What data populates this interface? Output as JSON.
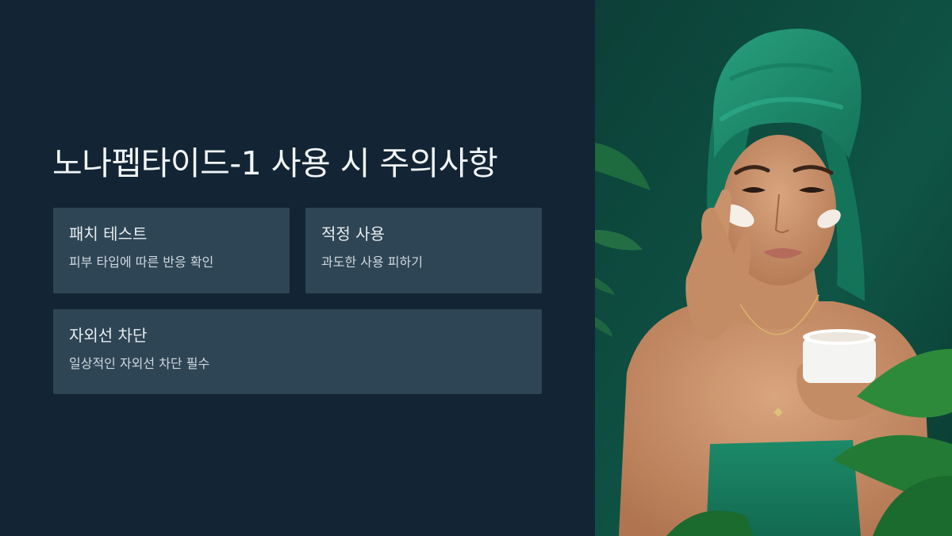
{
  "slide": {
    "title": "노나펩타이드-1 사용 시 주의사항"
  },
  "cards": [
    {
      "title": "패치 테스트",
      "desc": "피부 타입에 따른 반응 확인"
    },
    {
      "title": "적정 사용",
      "desc": "과도한 사용 피하기"
    },
    {
      "title": "자외선 차단",
      "desc": "일상적인 자외선 차단 필수"
    }
  ],
  "photo": {
    "subject": "woman-applying-cream-icon"
  },
  "colors": {
    "background": "#132534",
    "card": "#2e4555",
    "title_text": "#f2f5f7",
    "towel": "#1f8a6c",
    "photo_bg": "#0f4a3e"
  }
}
